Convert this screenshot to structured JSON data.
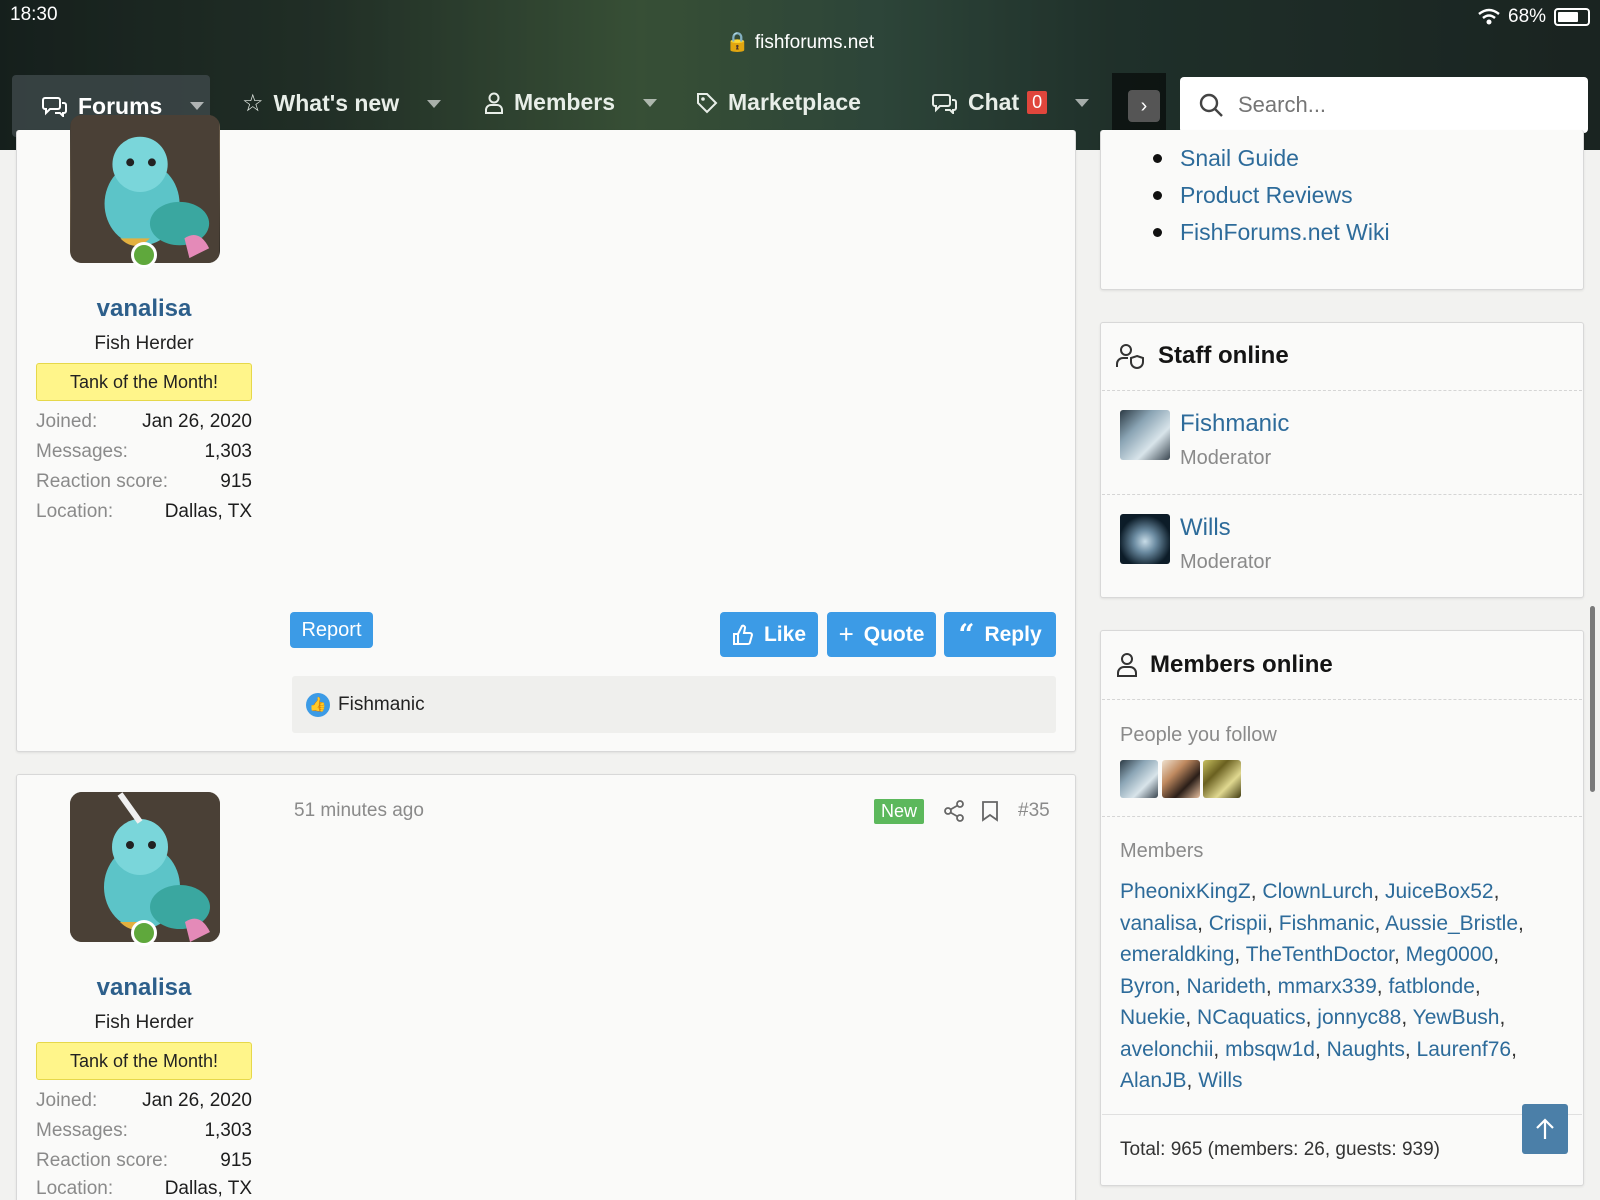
{
  "status_bar": {
    "time": "18:30",
    "battery": "68%",
    "url": "fishforums.net"
  },
  "nav": {
    "forums": "Forums",
    "whats_new": "What's new",
    "members": "Members",
    "marketplace": "Marketplace",
    "chat": "Chat",
    "chat_count": "0",
    "search_placeholder": "Search..."
  },
  "posts": [
    {
      "username": "vanalisa",
      "user_title": "Fish Herder",
      "banner": "Tank of the Month!",
      "stats": [
        {
          "label": "Joined:",
          "value": "Jan 26, 2020"
        },
        {
          "label": "Messages:",
          "value": "1,303"
        },
        {
          "label": "Reaction score:",
          "value": "915"
        },
        {
          "label": "Location:",
          "value": "Dallas, TX"
        }
      ],
      "report": "Report",
      "like": "Like",
      "quote": "Quote",
      "reply": "Reply",
      "reaction_user": "Fishmanic"
    },
    {
      "username": "vanalisa",
      "user_title": "Fish Herder",
      "banner": "Tank of the Month!",
      "time": "51 minutes ago",
      "new_badge": "New",
      "post_number": "#35",
      "stats": [
        {
          "label": "Joined:",
          "value": "Jan 26, 2020"
        },
        {
          "label": "Messages:",
          "value": "1,303"
        },
        {
          "label": "Reaction score:",
          "value": "915"
        },
        {
          "label": "Location:",
          "value": "Dallas, TX"
        }
      ]
    }
  ],
  "sidebar": {
    "links": [
      "Snail Guide",
      "Product Reviews",
      "FishForums.net Wiki"
    ],
    "staff": {
      "title": "Staff online",
      "members": [
        {
          "name": "Fishmanic",
          "role": "Moderator"
        },
        {
          "name": "Wills",
          "role": "Moderator"
        }
      ]
    },
    "online": {
      "title": "Members online",
      "follow_label": "People you follow",
      "members_label": "Members",
      "members": [
        "PheonixKingZ",
        "ClownLurch",
        "JuiceBox52",
        "vanalisa",
        "Crispii",
        "Fishmanic",
        "Aussie_Bristle",
        "emeraldking",
        "TheTenthDoctor",
        "Meg0000",
        "Byron",
        "Narideth",
        "mmarx339",
        "fatblonde",
        "Nuekie",
        "NCaquatics",
        "jonnyc88",
        "YewBush",
        "avelonchii",
        "mbsqw1d",
        "Naughts",
        "Laurenf76",
        "AlanJB",
        "Wills"
      ],
      "total": "Total: 965 (members: 26, guests: 939)"
    }
  },
  "colors": {
    "link": "#2d6b9a",
    "button": "#3c9be6",
    "new_badge": "#5cb85c",
    "chat_badge": "#e0463c",
    "banner": "#fff58a"
  }
}
